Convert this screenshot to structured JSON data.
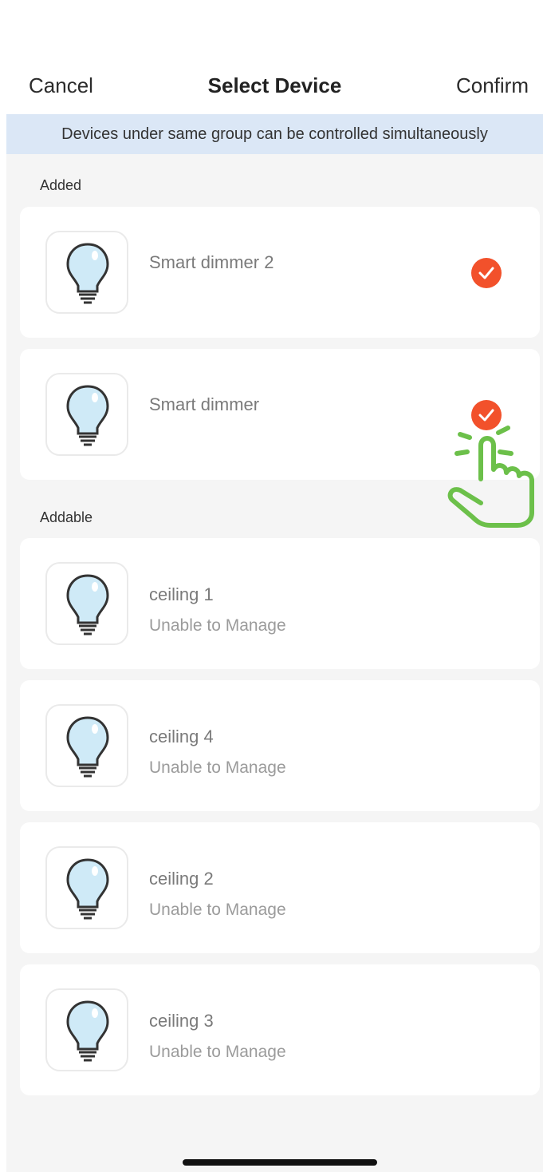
{
  "nav": {
    "cancel_label": "Cancel",
    "title": "Select Device",
    "confirm_label": "Confirm"
  },
  "banner": {
    "text": "Devices under same group can be controlled simultaneously"
  },
  "sections": {
    "added_label": "Added",
    "addable_label": "Addable"
  },
  "added_devices": [
    {
      "name": "Smart dimmer 2",
      "selected": true,
      "icon": "light-bulb-icon"
    },
    {
      "name": "Smart dimmer",
      "selected": true,
      "icon": "light-bulb-icon"
    }
  ],
  "addable_devices": [
    {
      "name": "ceiling 1",
      "status": "Unable to Manage",
      "icon": "light-bulb-icon"
    },
    {
      "name": "ceiling 4",
      "status": "Unable to Manage",
      "icon": "light-bulb-icon"
    },
    {
      "name": "ceiling 2",
      "status": "Unable to Manage",
      "icon": "light-bulb-icon"
    },
    {
      "name": "ceiling 3",
      "status": "Unable to Manage",
      "icon": "light-bulb-icon"
    }
  ],
  "colors": {
    "accent": "#f2512b",
    "banner": "#dbe7f6",
    "background": "#f5f5f5",
    "hand_hint": "#6cc04a",
    "bulb": "#cfeaf7"
  }
}
